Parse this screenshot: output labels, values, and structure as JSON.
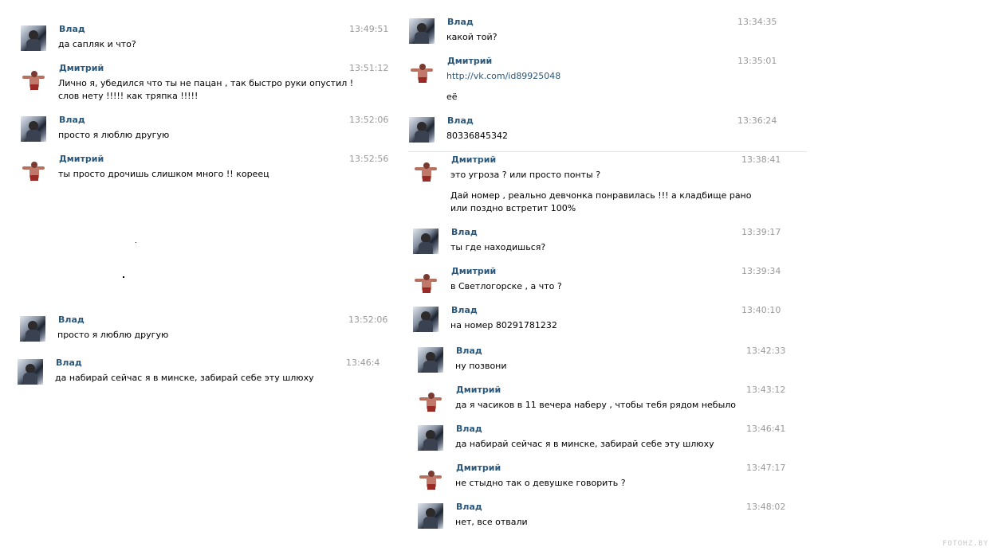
{
  "left_column": [
    {
      "author": "Влад",
      "avatar": "vlad",
      "time": "13:49:51",
      "lines": [
        "да сапляк и что?"
      ]
    },
    {
      "author": "Дмитрий",
      "avatar": "dima",
      "time": "13:51:12",
      "lines": [
        "Лично я, убедился что ты не пацан , так быстро руки опустил !",
        "слов нету !!!!! как тряпка !!!!!"
      ]
    },
    {
      "author": "Влад",
      "avatar": "vlad",
      "time": "13:52:06",
      "lines": [
        "просто я люблю другую"
      ]
    },
    {
      "author": "Дмитрий",
      "avatar": "dima",
      "time": "13:52:56",
      "lines": [
        "ты просто дрочишь слишком много !! кореец"
      ]
    },
    {
      "author": "Влад",
      "avatar": "vlad",
      "time": "13:52:06",
      "lines": [
        "просто я люблю другую"
      ]
    },
    {
      "author": "Влад",
      "avatar": "vlad",
      "time": "13:46:4",
      "lines": [
        "да набирай сейчас я в минске, забирай себе эту шлюху"
      ]
    }
  ],
  "right_column": [
    {
      "author": "Влад",
      "avatar": "vlad",
      "time": "13:34:35",
      "lines": [
        "какой той?"
      ]
    },
    {
      "author": "Дмитрий",
      "avatar": "dima",
      "time": "13:35:01",
      "link": "http://vk.com/id89925048",
      "lines": [
        "её"
      ]
    },
    {
      "author": "Влад",
      "avatar": "vlad",
      "time": "13:36:24",
      "lines": [
        "80336845342"
      ]
    },
    {
      "author": "Дмитрий",
      "avatar": "dima",
      "time": "13:38:41",
      "lines": [
        "это угроза ? или просто понты ?"
      ],
      "lines2": [
        "Дай номер , реально девчонка понравилась !!! а кладбище рано",
        "или поздно встретит 100%"
      ]
    },
    {
      "author": "Влад",
      "avatar": "vlad",
      "time": "13:39:17",
      "lines": [
        "ты где находишься?"
      ]
    },
    {
      "author": "Дмитрий",
      "avatar": "dima",
      "time": "13:39:34",
      "lines": [
        "в Светлогорске , а что ?"
      ]
    },
    {
      "author": "Влад",
      "avatar": "vlad",
      "time": "13:40:10",
      "lines": [
        "на номер 80291781232"
      ]
    },
    {
      "author": "Влад",
      "avatar": "vlad",
      "time": "13:42:33",
      "lines": [
        "ну позвони"
      ]
    },
    {
      "author": "Дмитрий",
      "avatar": "dima",
      "time": "13:43:12",
      "lines": [
        "да я часиков в 11 вечера наберу , чтобы тебя рядом небыло"
      ]
    },
    {
      "author": "Влад",
      "avatar": "vlad",
      "time": "13:46:41",
      "lines": [
        "да набирай сейчас я в минске, забирай себе эту шлюху"
      ]
    },
    {
      "author": "Дмитрий",
      "avatar": "dima",
      "time": "13:47:17",
      "lines": [
        "не стыдно так о девушке говорить ?"
      ]
    },
    {
      "author": "Влад",
      "avatar": "vlad",
      "time": "13:48:02",
      "lines": [
        "нет, все отвали"
      ]
    }
  ],
  "watermark": "FOTOHZ.BY",
  "colors": {
    "author": "#2b587a",
    "time": "#999999",
    "text": "#000000",
    "divider": "#e4e6e9"
  }
}
